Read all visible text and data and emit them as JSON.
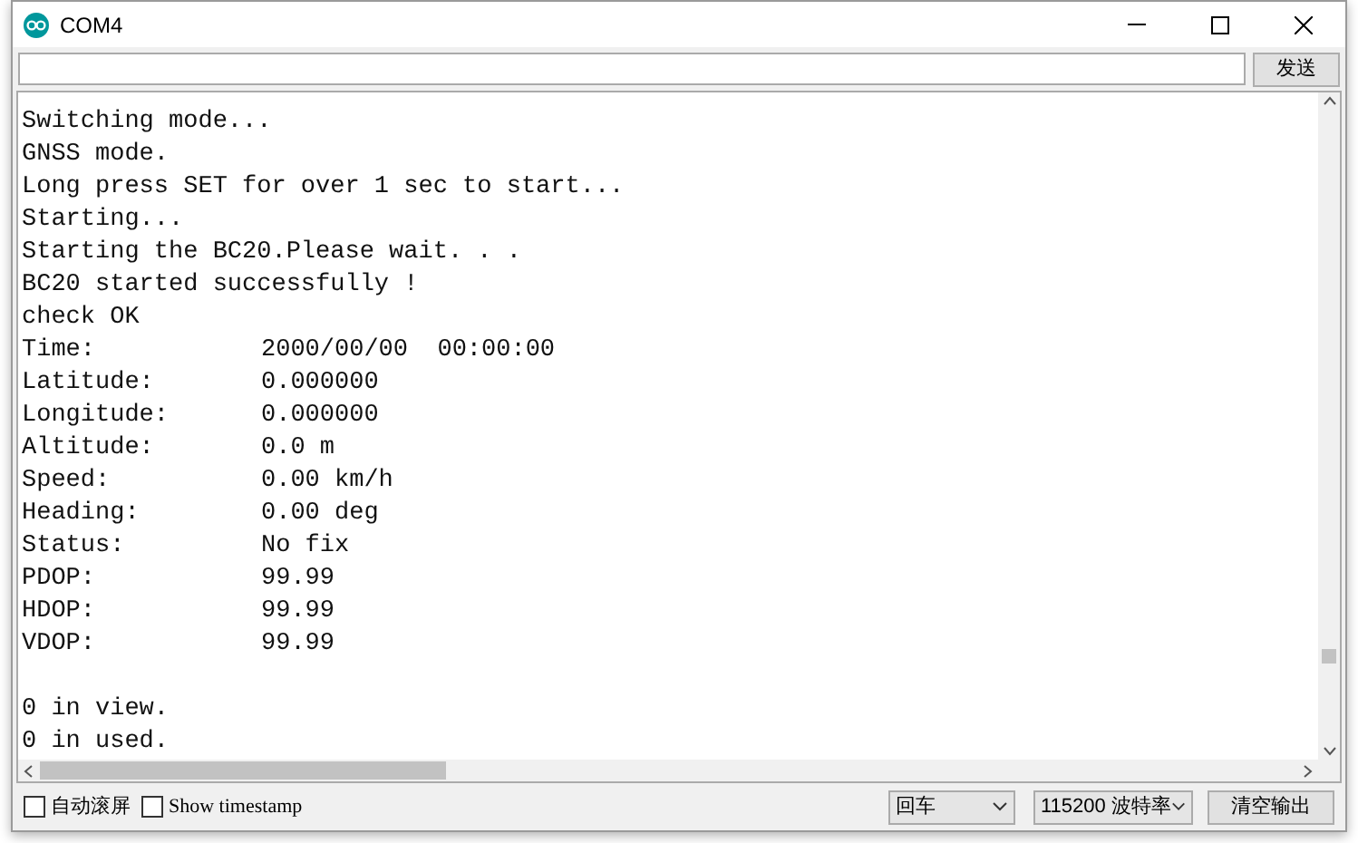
{
  "window": {
    "title": "COM4"
  },
  "send_bar": {
    "button": "发送"
  },
  "output": [
    {
      "kind": "plain",
      "text": "Switching mode..."
    },
    {
      "kind": "plain",
      "text": "GNSS mode."
    },
    {
      "kind": "plain",
      "text": "Long press SET for over 1 sec to start..."
    },
    {
      "kind": "plain",
      "text": "Starting..."
    },
    {
      "kind": "plain",
      "text": "Starting the BC20.Please wait. . ."
    },
    {
      "kind": "plain",
      "text": "BC20 started successfully !"
    },
    {
      "kind": "plain",
      "text": "check OK"
    },
    {
      "kind": "field",
      "label": "Time:",
      "value": "2000/00/00  00:00:00"
    },
    {
      "kind": "field",
      "label": "Latitude:",
      "value": "0.000000"
    },
    {
      "kind": "field",
      "label": "Longitude:",
      "value": "0.000000"
    },
    {
      "kind": "field",
      "label": "Altitude:",
      "value": "0.0 m"
    },
    {
      "kind": "field",
      "label": "Speed:",
      "value": "0.00 km/h"
    },
    {
      "kind": "field",
      "label": "Heading:",
      "value": "0.00 deg"
    },
    {
      "kind": "field",
      "label": "Status:",
      "value": "No fix"
    },
    {
      "kind": "field",
      "label": "PDOP:",
      "value": "99.99"
    },
    {
      "kind": "field",
      "label": "HDOP:",
      "value": "99.99"
    },
    {
      "kind": "field",
      "label": "VDOP:",
      "value": "99.99"
    },
    {
      "kind": "blank"
    },
    {
      "kind": "plain",
      "text": "0 in view."
    },
    {
      "kind": "plain",
      "text": "0 in used."
    }
  ],
  "footer": {
    "autoscroll": {
      "label": "自动滚屏",
      "checked": false
    },
    "timestamp": {
      "label": "Show timestamp",
      "checked": false
    },
    "line_ending": "回车",
    "baud_rate": "115200 波特率",
    "clear_button": "清空输出"
  }
}
